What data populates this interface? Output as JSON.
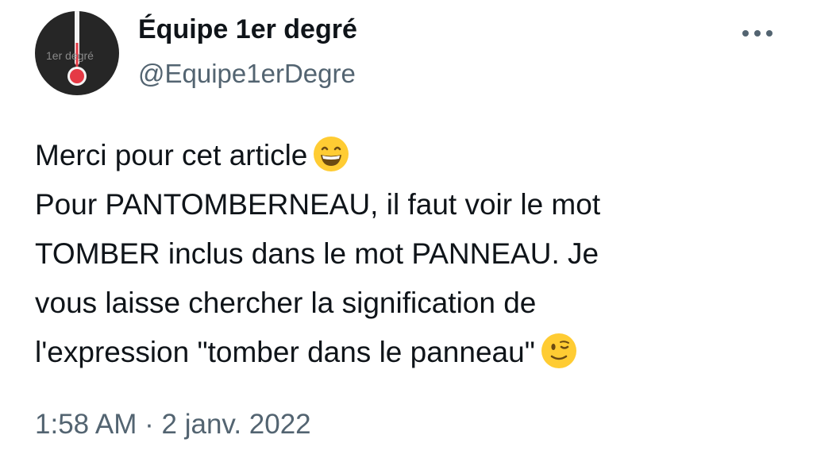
{
  "author": {
    "display_name": "Équipe 1er degré",
    "handle": "@Equipe1erDegre",
    "avatar_text": "1er degré"
  },
  "tweet": {
    "lines": [
      "Merci pour cet article",
      "Pour PANTOMBERNEAU, il faut voir le mot",
      "TOMBER inclus dans le mot PANNEAU. Je",
      "vous laisse chercher la signification de",
      "l'expression \"tomber dans le panneau\""
    ],
    "emojis": [
      "grinning-face-emoji",
      "winking-face-emoji"
    ]
  },
  "meta": {
    "timestamp": "1:58 AM · 2 janv. 2022"
  },
  "icons": {
    "more": "more-options-icon"
  },
  "colors": {
    "text": "#0f1419",
    "secondary": "#536471",
    "emoji_yellow": "#ffcc33",
    "avatar_bg": "#262626",
    "thermo_red": "#e53945"
  }
}
